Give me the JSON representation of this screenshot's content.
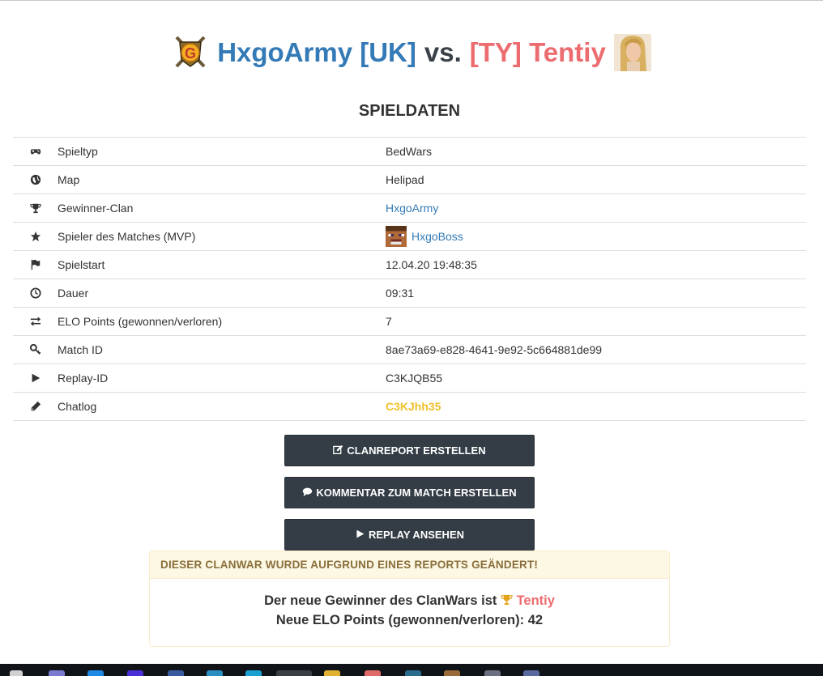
{
  "header": {
    "team1": "HxgoArmy [UK]",
    "vs": "vs.",
    "team2": "[TY] Tentiy"
  },
  "section_title": "SPIELDATEN",
  "rows": [
    {
      "icon": "gamepad-icon",
      "label": "Spieltyp",
      "value": "BedWars"
    },
    {
      "icon": "globe-icon",
      "label": "Map",
      "value": "Helipad"
    },
    {
      "icon": "trophy-icon",
      "label": "Gewinner-Clan",
      "value": "HxgoArmy"
    },
    {
      "icon": "star-icon",
      "label": "Spieler des Matches (MVP)",
      "value": "HxgoBoss"
    },
    {
      "icon": "flag-icon",
      "label": "Spielstart",
      "value": "12.04.20 19:48:35"
    },
    {
      "icon": "clock-icon",
      "label": "Dauer",
      "value": "09:31"
    },
    {
      "icon": "exchange-icon",
      "label": "ELO Points (gewonnen/verloren)",
      "value": "7"
    },
    {
      "icon": "key-icon",
      "label": "Match ID",
      "value": "8ae73a69-e828-4641-9e92-5c664881de99"
    },
    {
      "icon": "play-icon",
      "label": "Replay-ID",
      "value": "C3KJQB55"
    },
    {
      "icon": "pencil-icon",
      "label": "Chatlog",
      "value": "C3KJhh35"
    }
  ],
  "buttons": {
    "clanreport": "CLANREPORT ERSTELLEN",
    "comment": "KOMMENTAR ZUM MATCH ERSTELLEN",
    "replay": "REPLAY ANSEHEN"
  },
  "alert": {
    "heading": "DIESER CLANWAR WURDE AUFGRUND EINES REPORTS GEÄNDERT!",
    "winner_prefix": "Der neue Gewinner des ClanWars ist",
    "winner_name": "Tentiy",
    "elo_line": "Neue ELO Points (gewonnen/verloren): 42"
  },
  "colors": {
    "link": "#337ab7",
    "team2": "#ec6c6f",
    "chatlog": "#f0c02a",
    "button_bg": "#343d46",
    "alert_bg": "#fcf8e3",
    "alert_text": "#8a6d3b"
  }
}
